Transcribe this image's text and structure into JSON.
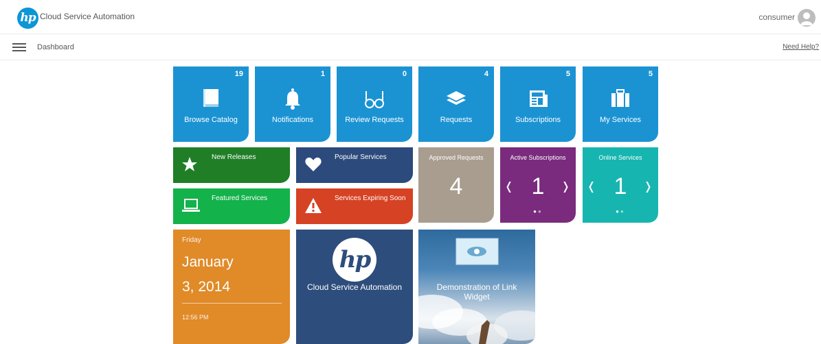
{
  "header": {
    "app_title": "Cloud Service Automation",
    "user": "consumer"
  },
  "subbar": {
    "breadcrumb": "Dashboard",
    "help": "Need Help?"
  },
  "nav_tiles": [
    {
      "label": "Browse Catalog",
      "count": "19"
    },
    {
      "label": "Notifications",
      "count": "1"
    },
    {
      "label": "Review Requests",
      "count": "0"
    },
    {
      "label": "Requests",
      "count": "4"
    },
    {
      "label": "Subscriptions",
      "count": "5"
    },
    {
      "label": "My Services",
      "count": "5"
    }
  ],
  "small_tiles": {
    "new_releases": "New Releases",
    "popular_services": "Popular Services",
    "featured_services": "Featured Services",
    "services_expiring": "Services Expiring Soon"
  },
  "stat_tiles": {
    "approved": {
      "title": "Approved Requests",
      "value": "4"
    },
    "active_subs": {
      "title": "Active Subscriptions",
      "value": "1"
    },
    "online": {
      "title": "Online Services",
      "value": "1"
    }
  },
  "calendar": {
    "weekday": "Friday",
    "month": "January",
    "day_year": "3, 2014",
    "time": "12:56 PM"
  },
  "csa_tile": {
    "title": "Cloud Service Automation"
  },
  "link_tile": {
    "title": "Demonstration of Link Widget"
  },
  "colors": {
    "nav": "#1b93d3",
    "new_releases": "#1f7e26",
    "popular": "#2c4a7c",
    "featured": "#13b24b",
    "expiring": "#d64224",
    "approved": "#a99d8f",
    "active_subs": "#7a2b7e",
    "online": "#17b5b0",
    "calendar": "#e08a28",
    "csa": "#2d4d7c"
  }
}
